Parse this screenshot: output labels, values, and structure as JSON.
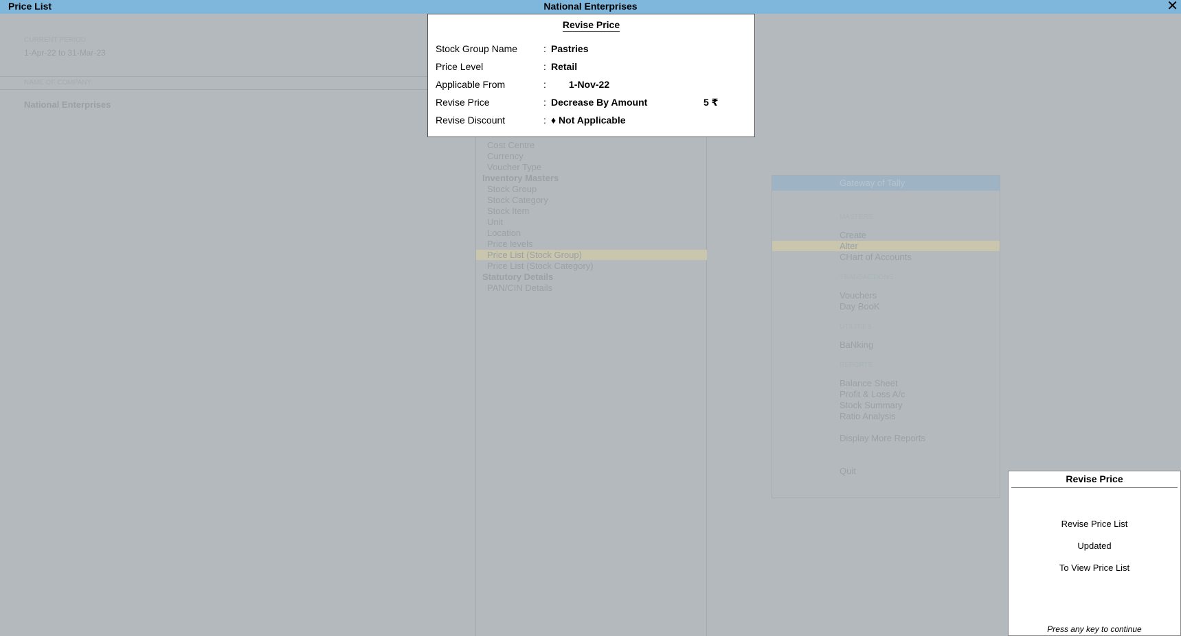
{
  "window": {
    "left_title": "Price List",
    "center_title": "National Enterprises",
    "close_glyph": "✕"
  },
  "company_panel": {
    "current_period_label": "CURRENT PERIOD",
    "current_period_value": "1-Apr-22 to 31-Mar-23",
    "company_label": "NAME OF COMPANY",
    "company_value": "National Enterprises"
  },
  "masters_list": {
    "items": [
      {
        "label": "Cost Centre",
        "kind": "item"
      },
      {
        "label": "Currency",
        "kind": "item"
      },
      {
        "label": "Voucher Type",
        "kind": "item"
      },
      {
        "label": "Inventory Masters",
        "kind": "heading"
      },
      {
        "label": "Stock Group",
        "kind": "item"
      },
      {
        "label": "Stock Category",
        "kind": "item"
      },
      {
        "label": "Stock Item",
        "kind": "item"
      },
      {
        "label": "Unit",
        "kind": "item"
      },
      {
        "label": "Location",
        "kind": "item"
      },
      {
        "label": "Price levels",
        "kind": "item"
      },
      {
        "label": "Price List (Stock Group)",
        "kind": "item",
        "selected": true
      },
      {
        "label": "Price List (Stock Category)",
        "kind": "item"
      },
      {
        "label": "Statutory Details",
        "kind": "heading"
      },
      {
        "label": "PAN/CIN Details",
        "kind": "item"
      }
    ]
  },
  "gateway": {
    "title": "Gateway of Tally",
    "masters_label": "MASTERS",
    "create": "Create",
    "alter": "Alter",
    "chart_of_accounts": "CHart of Accounts",
    "transactions_label": "TRANSACTIONS",
    "vouchers": "Vouchers",
    "day_book": "Day BooK",
    "utilities_label": "UTILITIES",
    "banking": "BaNking",
    "reports_label": "REPORTS",
    "balance_sheet": "Balance Sheet",
    "profit_loss": "Profit & Loss A/c",
    "stock_summary": "Stock Summary",
    "ratio_analysis": "Ratio Analysis",
    "display_more_reports": "Display More Reports",
    "quit": "Quit"
  },
  "revise_dialog": {
    "title": "Revise Price",
    "colon": ":",
    "stock_group_label": "Stock Group Name",
    "stock_group_value": "Pastries",
    "price_level_label": "Price Level",
    "price_level_value": "Retail",
    "applicable_from_label": "Applicable From",
    "applicable_from_value": "1-Nov-22",
    "revise_price_label": "Revise Price",
    "revise_price_value": "Decrease By Amount",
    "revise_price_amount": "5 ₹",
    "revise_discount_label": "Revise Discount",
    "revise_discount_value": "♦ Not Applicable"
  },
  "notice": {
    "title": "Revise Price",
    "line1": "Revise Price List",
    "line2": "Updated",
    "line3": "To View Price List",
    "footer": "Press any key to continue"
  }
}
